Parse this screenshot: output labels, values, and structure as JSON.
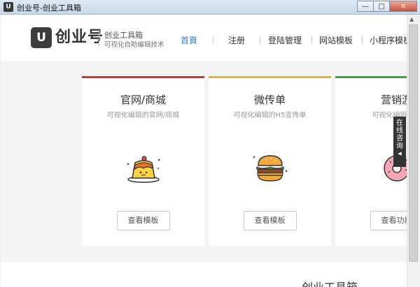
{
  "window": {
    "title": "创业号-创业工具箱",
    "app_icon": "U",
    "minimize": "—",
    "maximize": "□",
    "close": "✕"
  },
  "header": {
    "logo_mark": "U",
    "logo_text": "创业号",
    "brand_name": "创业工具箱",
    "brand_slogan": "可视化自助编辑技术"
  },
  "nav": {
    "items": [
      "首頁",
      "注册",
      "登陆管理",
      "网站模板",
      "小程序模板"
    ],
    "active_color": "#3b78c4"
  },
  "cards": [
    {
      "title": "官网/商城",
      "subtitle": "可视化编辑的官网/商城",
      "button": "查看模板",
      "accent": "#c43b35",
      "icon": "pudding-icon"
    },
    {
      "title": "微传单",
      "subtitle": "可视化编辑的H5宣传单",
      "button": "查看模板",
      "accent": "#e0b52c",
      "icon": "burger-icon"
    },
    {
      "title": "营销游",
      "subtitle": "可视化编辑的营",
      "button": "查看功能",
      "accent": "#3aa63a",
      "icon": "donut-icon"
    }
  ],
  "consult_tab": "在线咨询",
  "bottom": {
    "title": "创业工具箱"
  }
}
